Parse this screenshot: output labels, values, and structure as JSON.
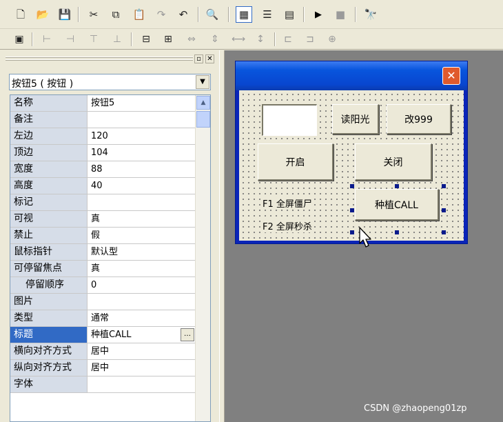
{
  "toolbar1": {
    "buttons": [
      "new-icon",
      "open-icon",
      "save-icon",
      "cut-icon",
      "copy-icon",
      "paste-icon",
      "redo-icon",
      "undo-icon",
      "find-icon",
      "layout-a-icon",
      "layout-b-icon",
      "layout-c-icon",
      "run-icon",
      "stop-icon",
      "debug-icon"
    ]
  },
  "toolbar2": {
    "buttons": [
      "form-icon",
      "align-left-icon",
      "align-right-icon",
      "align-top-icon",
      "align-bottom-icon",
      "center-h-icon",
      "center-v-icon",
      "same-width-icon",
      "same-height-icon",
      "space-h-icon",
      "space-v-icon",
      "fit-width-icon",
      "fit-height-icon",
      "center-both-icon"
    ]
  },
  "panel": {
    "combo_value": "按钮5 ( 按钮 )",
    "properties": [
      {
        "name": "名称",
        "value": "按钮5"
      },
      {
        "name": "备注",
        "value": ""
      },
      {
        "name": "左边",
        "value": "120"
      },
      {
        "name": "顶边",
        "value": "104"
      },
      {
        "name": "宽度",
        "value": "88"
      },
      {
        "name": "高度",
        "value": "40"
      },
      {
        "name": "标记",
        "value": ""
      },
      {
        "name": "可视",
        "value": "真"
      },
      {
        "name": "禁止",
        "value": "假"
      },
      {
        "name": "鼠标指针",
        "value": "默认型"
      },
      {
        "name": "可停留焦点",
        "value": "真"
      },
      {
        "name": "停留顺序",
        "value": "0"
      },
      {
        "name": "图片",
        "value": ""
      },
      {
        "name": "类型",
        "value": "通常"
      },
      {
        "name": "标题",
        "value": "种植CALL"
      },
      {
        "name": "横向对齐方式",
        "value": "居中"
      },
      {
        "name": "纵向对齐方式",
        "value": "居中"
      },
      {
        "name": "字体",
        "value": ""
      }
    ],
    "ellipsis_label": "…"
  },
  "form": {
    "close_label": "✕",
    "btn_read_sun": "读阳光",
    "btn_set_999": "改999",
    "btn_start": "开启",
    "btn_close": "关闭",
    "btn_plant_call": "种植CALL",
    "label_f1": "F1  全屏僵尸",
    "label_f2": "F2  全屏秒杀"
  },
  "watermark": "CSDN @zhaopeng01zp",
  "colors": {
    "selection": "#316ac5",
    "titlebar": "#0855dd",
    "close_button": "#e05a2c",
    "design_surface": "#808080"
  }
}
